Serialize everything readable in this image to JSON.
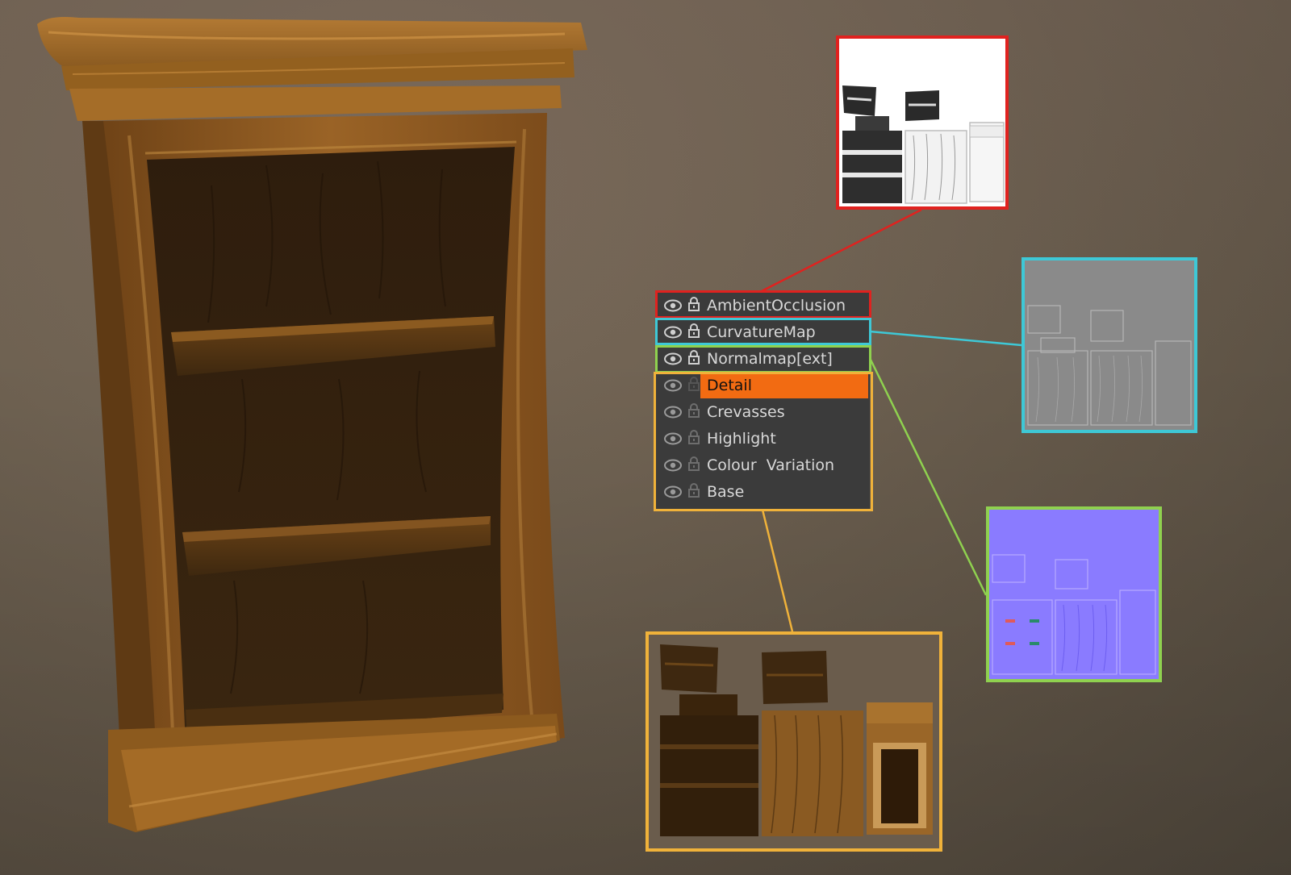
{
  "colors": {
    "ambient_occlusion": "#e0221f",
    "curvature": "#3ec8d6",
    "normal": "#8fd14f",
    "group": "#f0b23a",
    "selected_layer": "#f26b12",
    "panel_bg": "#3b3b3b",
    "normal_map_bg": "#8a7bff",
    "curvature_bg": "#8a8a8a"
  },
  "layers_panel": {
    "layers": [
      {
        "name": "AmbientOcclusion",
        "visibility_icon": "eye-icon",
        "lock_icon": "lock-icon",
        "selected": false
      },
      {
        "name": "CurvatureMap",
        "visibility_icon": "eye-icon",
        "lock_icon": "lock-icon",
        "selected": false
      },
      {
        "name": "Normalmap[ext]",
        "visibility_icon": "eye-icon",
        "lock_icon": "lock-icon",
        "selected": false
      },
      {
        "name": "Detail",
        "visibility_icon": "eye-icon",
        "lock_icon": "lock-icon",
        "selected": true
      },
      {
        "name": "Crevasses",
        "visibility_icon": "eye-icon",
        "lock_icon": "lock-icon",
        "selected": false
      },
      {
        "name": "Highlight",
        "visibility_icon": "eye-icon",
        "lock_icon": "lock-icon",
        "selected": false
      },
      {
        "name": "Colour  Variation",
        "visibility_icon": "eye-icon",
        "lock_icon": "lock-icon",
        "selected": false
      },
      {
        "name": "Base",
        "visibility_icon": "eye-icon",
        "lock_icon": "lock-icon",
        "selected": false
      }
    ]
  }
}
